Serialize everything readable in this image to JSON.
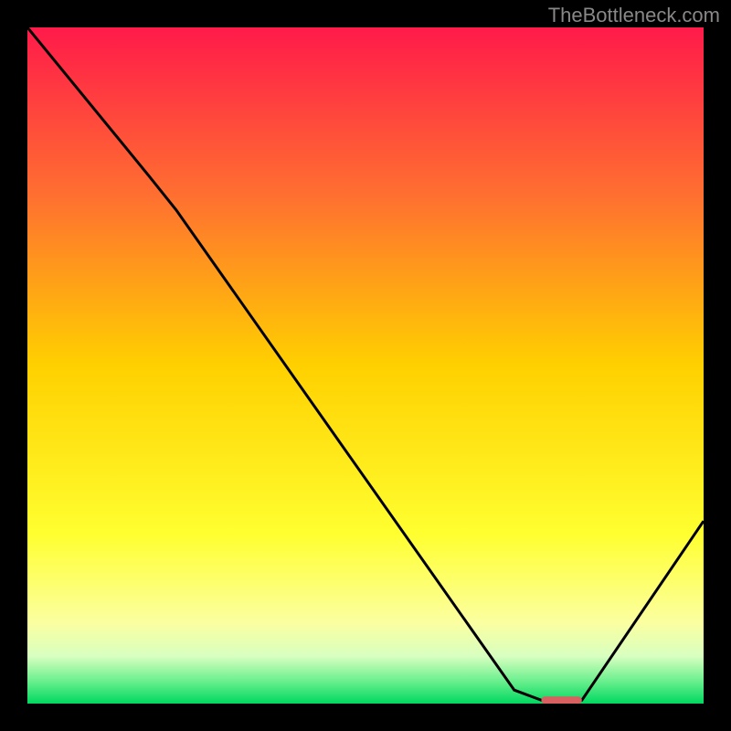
{
  "watermark": "TheBottleneck.com",
  "chart_data": {
    "type": "line",
    "title": "",
    "xlabel": "",
    "ylabel": "",
    "xlim": [
      0,
      100
    ],
    "ylim": [
      0,
      100
    ],
    "curve": [
      {
        "x": 0,
        "y": 100
      },
      {
        "x": 18,
        "y": 78
      },
      {
        "x": 22,
        "y": 73
      },
      {
        "x": 72,
        "y": 2
      },
      {
        "x": 76,
        "y": 0.5
      },
      {
        "x": 82,
        "y": 0.5
      },
      {
        "x": 100,
        "y": 27
      }
    ],
    "marker_segment": {
      "x_start": 76,
      "x_end": 82,
      "color": "#d86060"
    },
    "background_gradient": {
      "stops": [
        {
          "offset": 0,
          "color": "#ff1a4a"
        },
        {
          "offset": 0.25,
          "color": "#ff7030"
        },
        {
          "offset": 0.5,
          "color": "#ffd000"
        },
        {
          "offset": 0.75,
          "color": "#ffff30"
        },
        {
          "offset": 0.88,
          "color": "#fbffa0"
        },
        {
          "offset": 0.93,
          "color": "#d8ffc0"
        },
        {
          "offset": 0.965,
          "color": "#70f090"
        },
        {
          "offset": 1.0,
          "color": "#00d860"
        }
      ]
    }
  }
}
